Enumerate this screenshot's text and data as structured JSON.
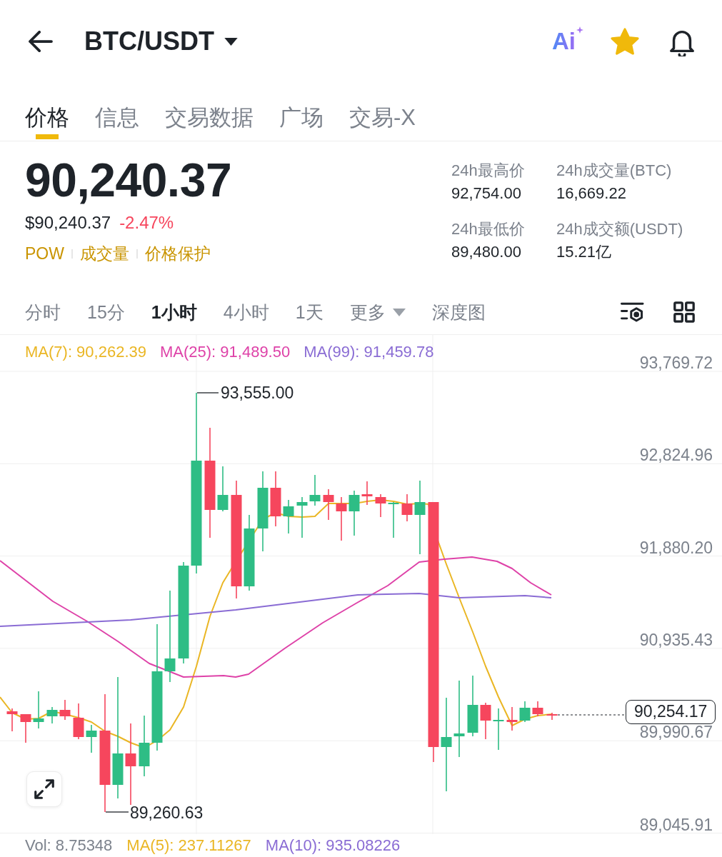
{
  "header": {
    "title": "BTC/USDT",
    "ai_label": "Ai",
    "favorite": true
  },
  "tabs": [
    {
      "label": "价格",
      "selected": true
    },
    {
      "label": "信息",
      "selected": false
    },
    {
      "label": "交易数据",
      "selected": false
    },
    {
      "label": "广场",
      "selected": false
    },
    {
      "label": "交易-X",
      "selected": false
    }
  ],
  "ticker": {
    "last_price": "90,240.37",
    "usd_price": "$90,240.37",
    "change": "-2.47%",
    "tags": [
      "POW",
      "成交量",
      "价格保护"
    ]
  },
  "stats": [
    {
      "label": "24h最高价",
      "value": "92,754.00"
    },
    {
      "label": "24h成交量(BTC)",
      "value": "16,669.22"
    },
    {
      "label": "24h最低价",
      "value": "89,480.00"
    },
    {
      "label": "24h成交额(USDT)",
      "value": "15.21亿"
    }
  ],
  "intervals": [
    {
      "label": "分时",
      "kind": "option",
      "selected": false
    },
    {
      "label": "15分",
      "kind": "option",
      "selected": false
    },
    {
      "label": "1小时",
      "kind": "option",
      "selected": true
    },
    {
      "label": "4小时",
      "kind": "option",
      "selected": false
    },
    {
      "label": "1天",
      "kind": "option",
      "selected": false
    },
    {
      "label": "更多",
      "kind": "dropdown",
      "selected": false
    },
    {
      "label": "深度图",
      "kind": "option",
      "selected": false
    }
  ],
  "chart": {
    "indicators": [
      {
        "label": "MA(7): 90,262.39",
        "color": "#eab624"
      },
      {
        "label": "MA(25): 91,489.50",
        "color": "#de42a8"
      },
      {
        "label": "MA(99): 91,459.78",
        "color": "#8a6cd4"
      }
    ],
    "price_axis": [
      "93,769.72",
      "92,824.96",
      "91,880.20",
      "90,935.43",
      "89,990.67",
      "89,045.91"
    ],
    "high_label": "93,555.00",
    "low_label": "89,260.63",
    "current_price": "90,254.17"
  },
  "volume_legend": [
    {
      "label": "Vol: 8.75348",
      "color": "#7c828c"
    },
    {
      "label": "MA(5): 237.11267",
      "color": "#eab624"
    },
    {
      "label": "MA(10): 935.08226",
      "color": "#8a6cd4"
    }
  ]
}
